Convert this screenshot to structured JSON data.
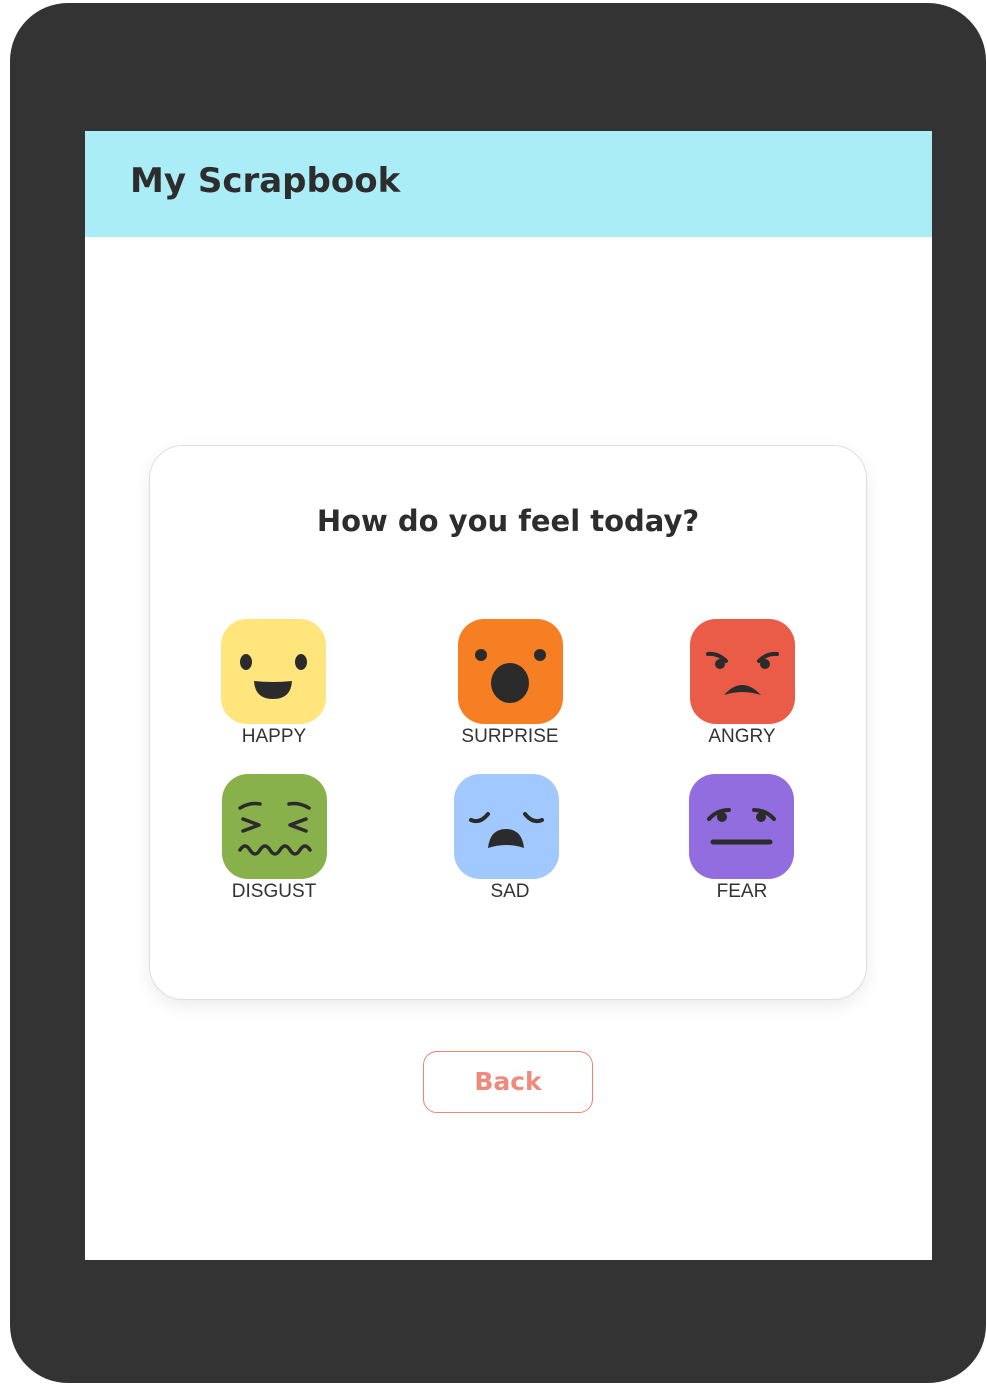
{
  "header": {
    "title": "My Scrapbook",
    "background_color": "#aaedf6"
  },
  "mood_card": {
    "question": "How do you feel today?",
    "moods": [
      {
        "label": "HAPPY",
        "icon": "happy-face-icon",
        "color": "#ffe57c"
      },
      {
        "label": "SURPRISE",
        "icon": "surprised-face-icon",
        "color": "#f57f22"
      },
      {
        "label": "ANGRY",
        "icon": "angry-face-icon",
        "color": "#ea5c48"
      },
      {
        "label": "DISGUST",
        "icon": "disgusted-face-icon",
        "color": "#88b04b"
      },
      {
        "label": "SAD",
        "icon": "sad-face-icon",
        "color": "#a1c8ff"
      },
      {
        "label": "FEAR",
        "icon": "fearful-face-icon",
        "color": "#916ddf"
      }
    ]
  },
  "actions": {
    "back_label": "Back",
    "accent_color": "#ee8b7c"
  },
  "device": {
    "frame_color": "#333333"
  }
}
